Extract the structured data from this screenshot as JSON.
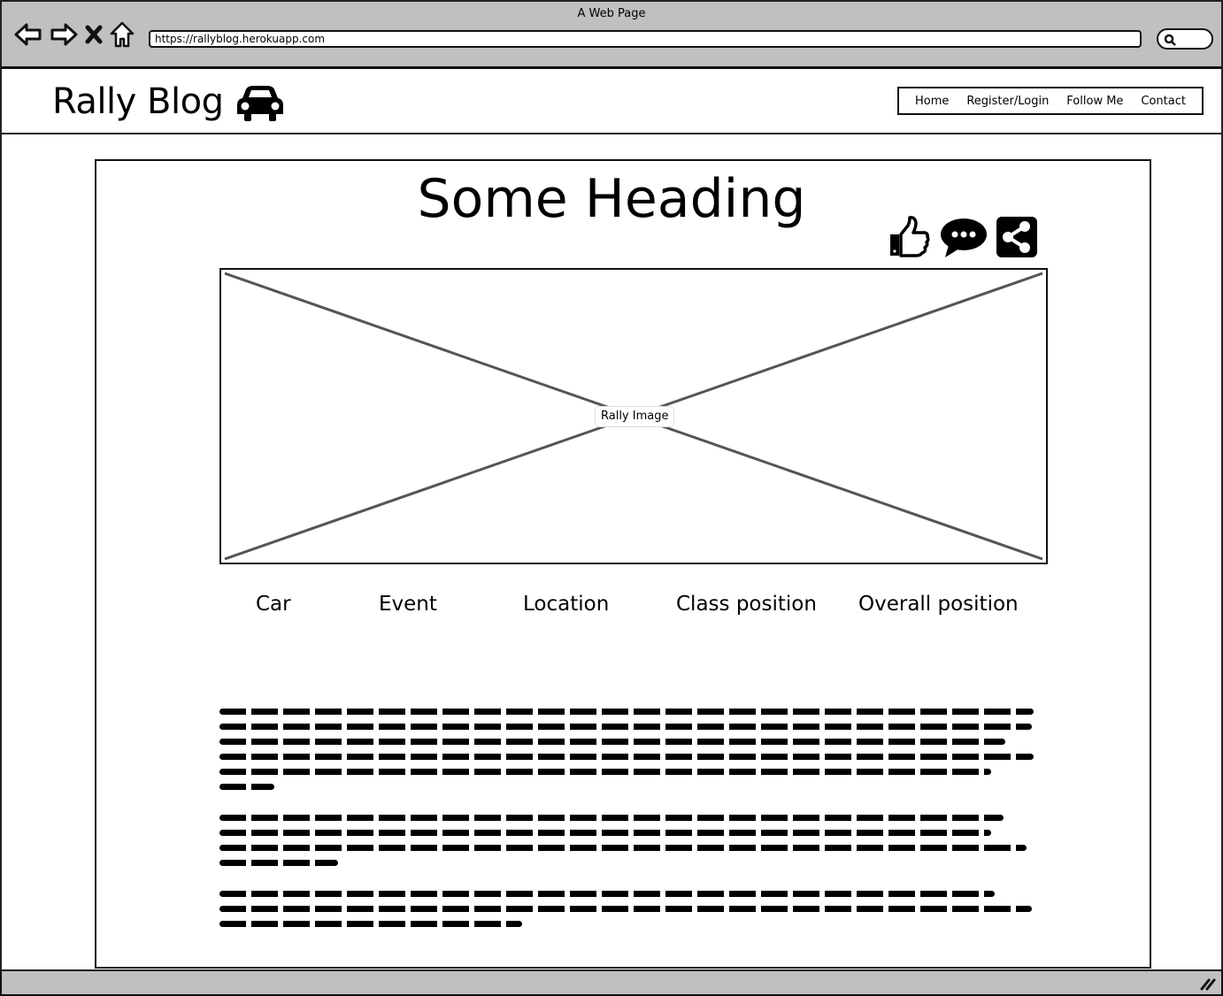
{
  "browser": {
    "window_title": "A Web Page",
    "url": "https://rallyblog.herokuapp.com",
    "nav_icons": [
      "back-arrow-icon",
      "forward-arrow-icon",
      "close-x-icon",
      "home-icon"
    ],
    "search_icon": "search-icon"
  },
  "header": {
    "brand": "Rally Blog",
    "brand_icon": "car-icon",
    "nav": [
      {
        "label": "Home"
      },
      {
        "label": "Register/Login"
      },
      {
        "label": "Follow Me"
      },
      {
        "label": "Contact"
      }
    ]
  },
  "post": {
    "heading": "Some Heading",
    "actions": [
      "thumbs-up-icon",
      "comment-icon",
      "share-icon"
    ],
    "image_label": "Rally Image",
    "stats": [
      {
        "label": "Car"
      },
      {
        "label": "Event"
      },
      {
        "label": "Location"
      },
      {
        "label": "Class position"
      },
      {
        "label": "Overall position"
      }
    ],
    "paragraphs": [
      {
        "lines": 6,
        "note": "placeholder scribble text"
      },
      {
        "lines": 4,
        "note": "placeholder scribble text"
      },
      {
        "lines": 3,
        "note": "placeholder scribble text"
      }
    ]
  },
  "status_bar": {
    "grip_icon": "resize-grip-icon"
  }
}
